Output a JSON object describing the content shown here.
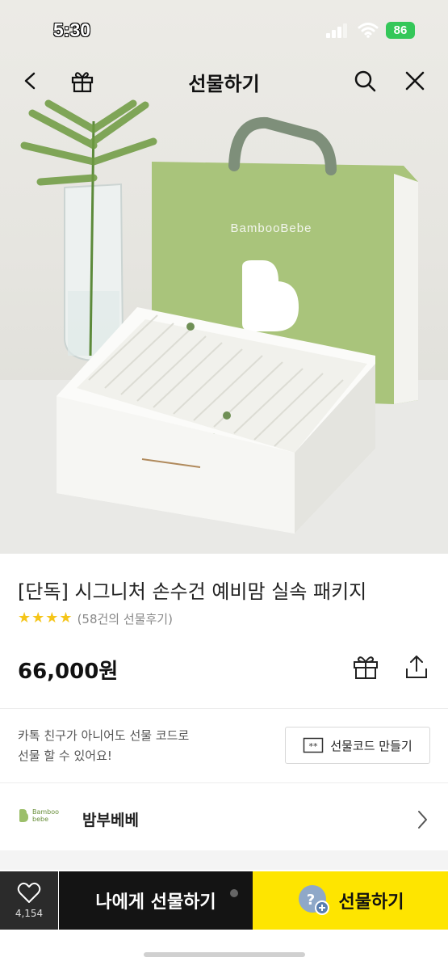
{
  "status": {
    "time": "5:30",
    "battery": "86"
  },
  "nav": {
    "title": "선물하기"
  },
  "hero_image": {
    "brand_print": "BambooBebe"
  },
  "product": {
    "title": "[단독] 시그니처 손수건 예비맘 실속 패키지",
    "stars": 4,
    "review_count": "(58건의 선물후기)",
    "price": "66,000원"
  },
  "gift_code": {
    "description": "카톡 친구가 아니어도 선물 코드로\n선물 할 수 있어요!",
    "button_label": "선물코드 만들기",
    "button_icon_text": "**"
  },
  "brand": {
    "logo_line1": "Bamboo",
    "logo_line2": "bebe",
    "name": "밤부베베"
  },
  "bottom": {
    "wish_count": "4,154",
    "gift_self_label": "나에게 선물하기",
    "gift_label": "선물하기"
  },
  "colors": {
    "accent_yellow": "#fee500",
    "star": "#f5c518",
    "brand_green": "#a9c47b",
    "dark": "#141414"
  }
}
